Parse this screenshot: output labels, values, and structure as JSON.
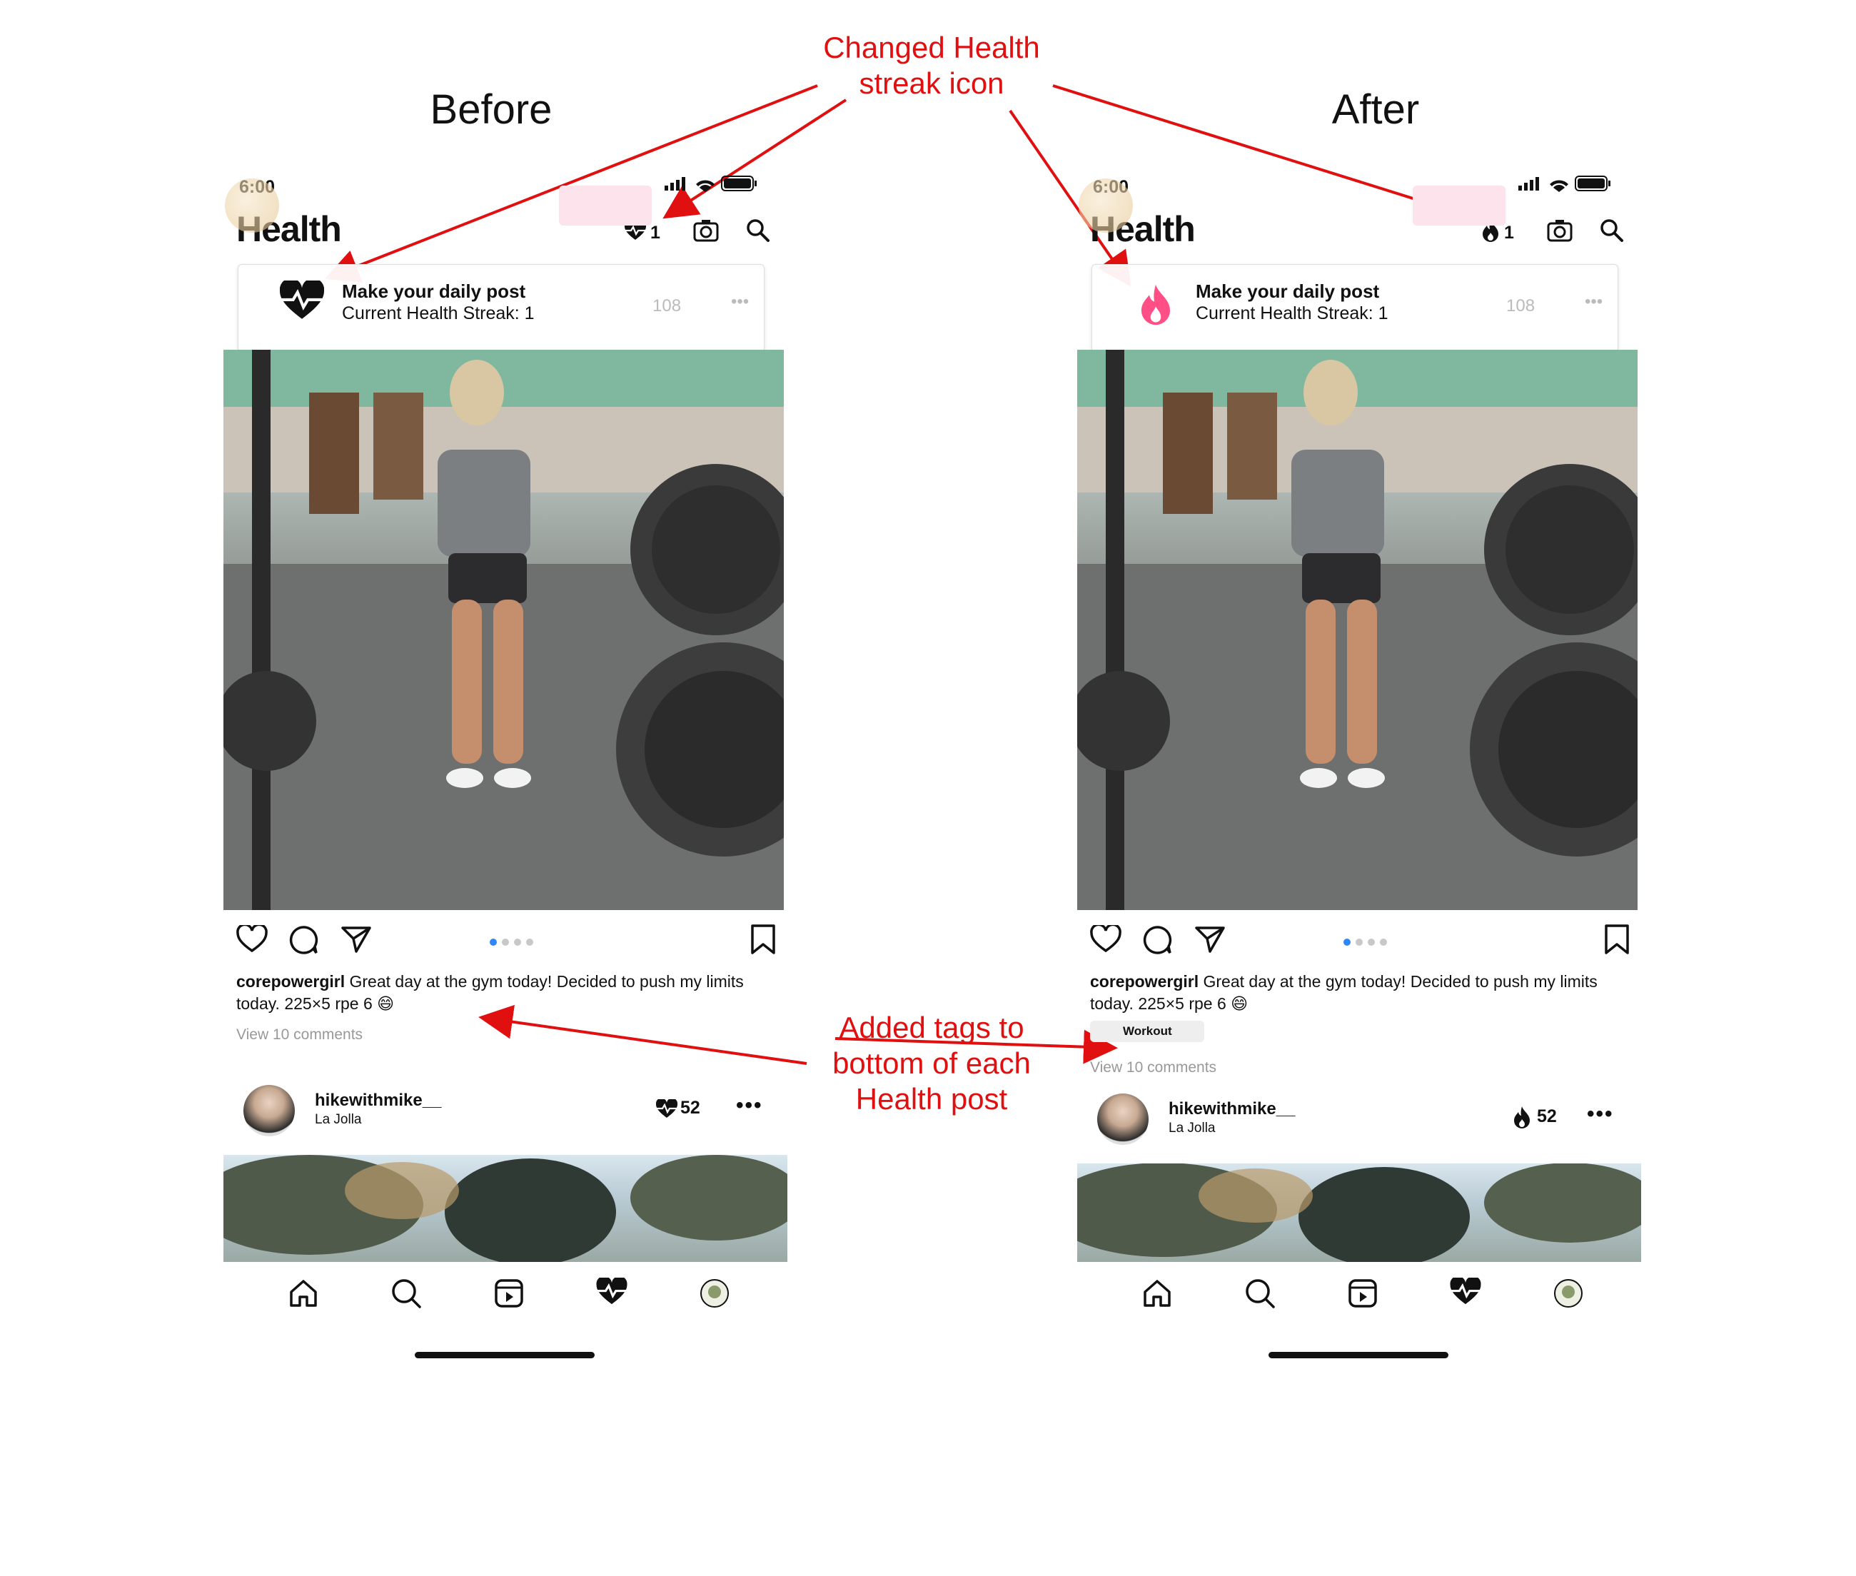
{
  "labels": {
    "before": "Before",
    "after": "After"
  },
  "annotations": {
    "icon_change": [
      "Changed Health",
      "streak icon"
    ],
    "tags_added": [
      "Added tags to",
      "bottom of each",
      "Health post"
    ]
  },
  "colors": {
    "annotation": "#e01010",
    "flame": "#ff4f86",
    "dot_active": "#2f86f6"
  },
  "phones": [
    {
      "status_time": "6:00",
      "app_title": "Health",
      "streak_icon": "heartbeat-icon",
      "streak_count": "1",
      "banner": {
        "title": "Make your daily post",
        "subtitle": "Current Health Streak: 1",
        "likes_ghost": "108"
      },
      "post": {
        "username": "corepowergirl",
        "caption": " Great day at the gym today! Decided to push my limits today. 225×5 rpe 6 😄",
        "tag": "",
        "comments": "View 10 comments"
      },
      "post2": {
        "username": "hikewithmike__",
        "location": "La Jolla",
        "count": "52"
      }
    },
    {
      "status_time": "6:00",
      "app_title": "Health",
      "streak_icon": "flame-icon",
      "streak_count": "1",
      "banner": {
        "title": "Make your daily post",
        "subtitle": "Current Health Streak: 1",
        "likes_ghost": "108"
      },
      "post": {
        "username": "corepowergirl",
        "caption": " Great day at the gym today! Decided to push my limits today. 225×5 rpe 6 😄",
        "tag": "Workout",
        "comments": "View 10 comments"
      },
      "post2": {
        "username": "hikewithmike__",
        "location": "La Jolla",
        "count": "52"
      }
    }
  ]
}
